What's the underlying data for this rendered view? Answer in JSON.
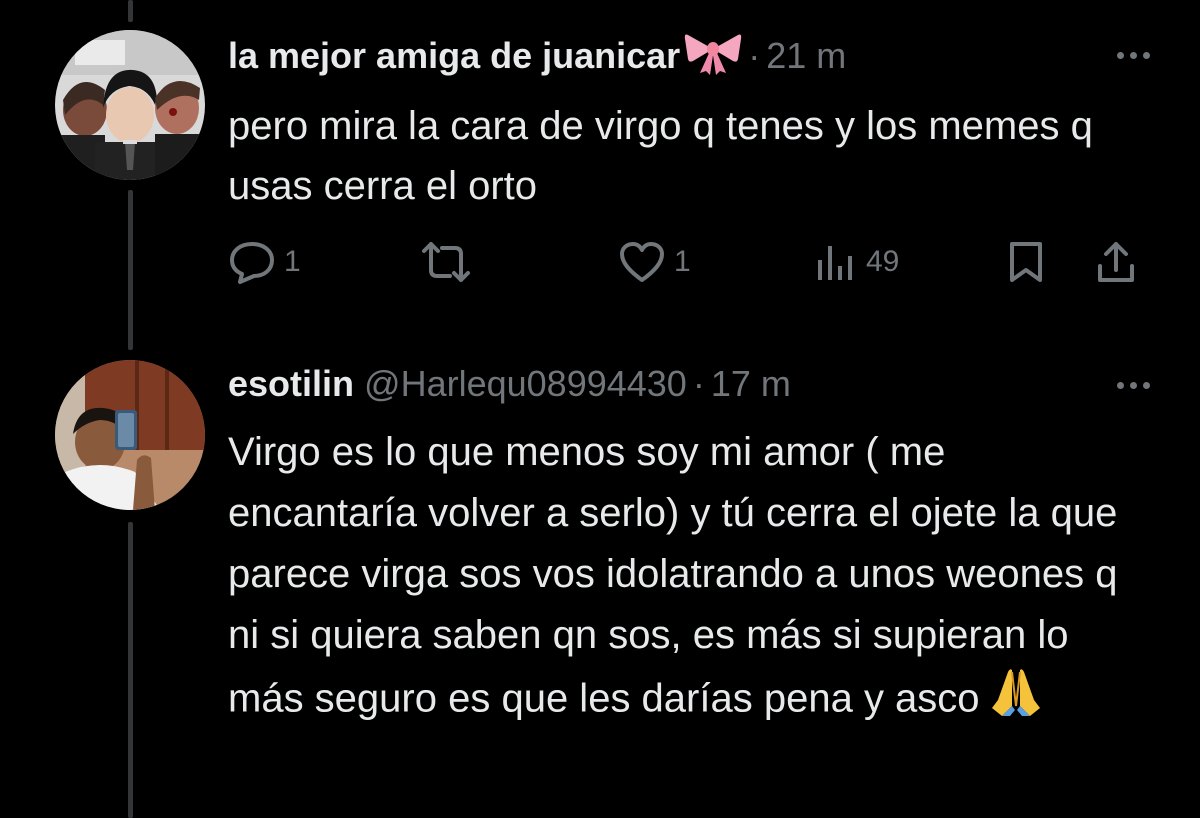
{
  "tweets": [
    {
      "display_name": "la mejor amiga de juanicar",
      "name_emoji": "ribbon-bow-icon",
      "handle": "",
      "separator": "·",
      "time": "21 m",
      "text": "pero mira la cara de virgo q tenes y los memes q usas cerra el orto",
      "actions": {
        "reply_count": "1",
        "retweet_count": "",
        "like_count": "1",
        "views_count": "49"
      }
    },
    {
      "display_name": "esotilin",
      "handle": "@Harlequ08994430",
      "separator": "·",
      "time": "17 m",
      "text": "Virgo es lo que menos soy mi amor ( me encantaría volver a serlo) y tú cerra el ojete la que parece virga sos vos idolatrando a unos weones q ni si quiera saben qn sos, es más si supieran lo más seguro es que les darías pena y asco",
      "end_emoji": "folded-hands-icon"
    }
  ],
  "colors": {
    "background": "#000000",
    "text": "#e7e9ea",
    "muted": "#71767b",
    "thread_line": "#333639"
  }
}
